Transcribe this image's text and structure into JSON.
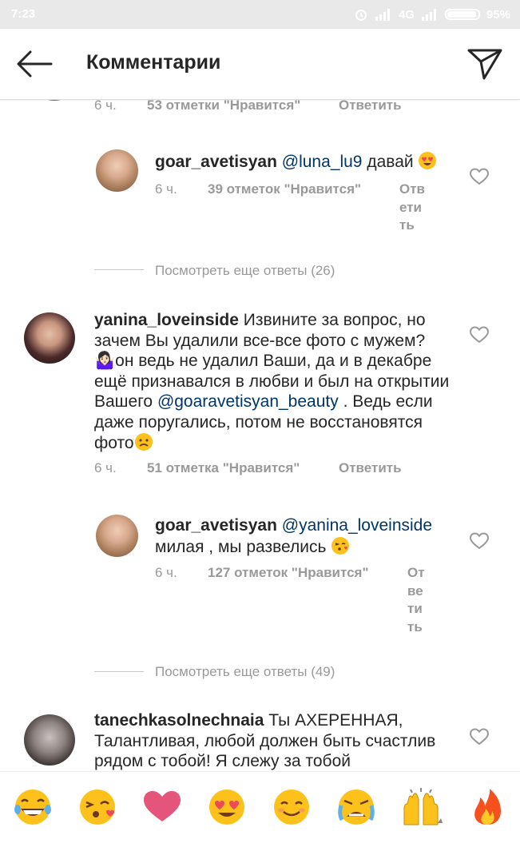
{
  "status_bar": {
    "time": "7:23",
    "network": "4G",
    "battery": "95%",
    "battery_level": 0.95
  },
  "header": {
    "title": "Комментарии"
  },
  "top_comment_meta": {
    "time": "6 ч.",
    "likes": "53 отметки \"Нравится\"",
    "reply": "Ответить"
  },
  "reply1": {
    "username": "goar_avetisyan",
    "mention": "@luna_lu9",
    "text": "давай",
    "time": "6 ч.",
    "likes": "39 отметок \"Нравится\"",
    "reply_lines": [
      "Отв",
      "ети",
      "ть"
    ]
  },
  "view_more_1": "Посмотреть еще ответы (26)",
  "comment2": {
    "username": "yanina_loveinside",
    "text_before_mention": "Извините за вопрос, но зачем Вы удалили все-все фото с мужем? 🤷🏻‍♀️он ведь не удалил Ваши, да и в декабре ещё признавался в любви и был на открытии Вашего",
    "mention": "@goaravetisyan_beauty",
    "text_after_mention": ". Ведь если даже поругались, потом не восстановятся фото",
    "time": "6 ч.",
    "likes": "51 отметка \"Нравится\"",
    "reply": "Ответить"
  },
  "reply2": {
    "username": "goar_avetisyan",
    "mention": "@yanina_loveinside",
    "text": "милая , мы развелись",
    "time": "6 ч.",
    "likes": "127 отметок \"Нравится\"",
    "reply_lines": [
      "От",
      "ве",
      "ти",
      "ть"
    ]
  },
  "view_more_2": "Посмотреть еще ответы (49)",
  "comment3": {
    "username": "tanechkasolnechnaia",
    "text": "Ты АХЕРЕННАЯ, Талантливая, любой должен быть счастлив рядом с тобой! Я слежу за тобой"
  },
  "emoji_bar": [
    "grinning-tears",
    "kissing-heart",
    "heart",
    "heart-eyes",
    "smile",
    "crying",
    "raised-hands",
    "fire"
  ],
  "colors": {
    "text": "#262626",
    "muted": "#999999",
    "mention": "#003569",
    "heart": "#ed4956",
    "emoji_yellow": "#fcc21b"
  }
}
